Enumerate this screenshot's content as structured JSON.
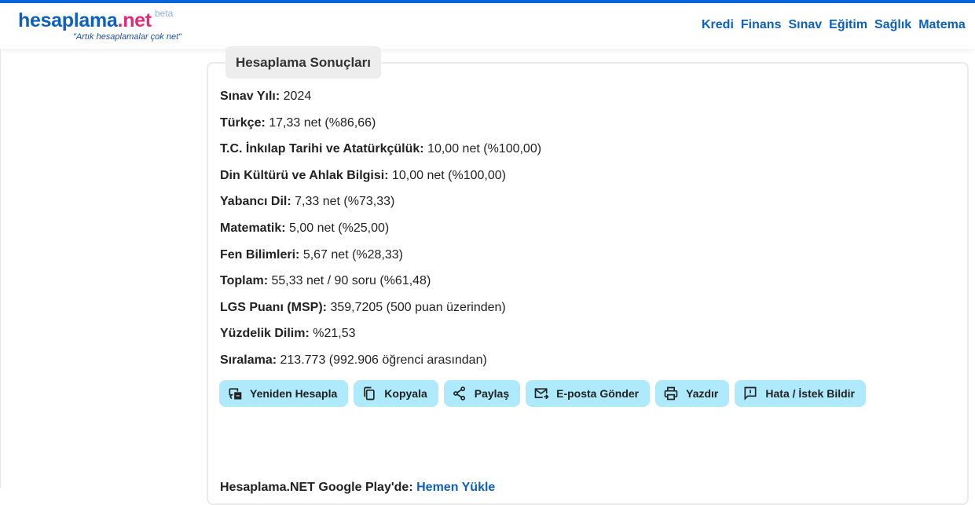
{
  "logo": {
    "name": "hesaplama",
    "tld": ".net",
    "beta": "beta",
    "slogan": "\"Artık hesaplamalar çok net\""
  },
  "nav": {
    "items": [
      "Kredi",
      "Finans",
      "Sınav",
      "Eğitim",
      "Sağlık",
      "Matema"
    ]
  },
  "card": {
    "title": "Hesaplama Sonuçları"
  },
  "results": [
    {
      "label": "Sınav Yılı:",
      "value": "2024"
    },
    {
      "label": "Türkçe:",
      "value": "17,33 net (%86,66)"
    },
    {
      "label": "T.C. İnkılap Tarihi ve Atatürkçülük:",
      "value": "10,00 net (%100,00)"
    },
    {
      "label": "Din Kültürü ve Ahlak Bilgisi:",
      "value": "10,00 net (%100,00)"
    },
    {
      "label": "Yabancı Dil:",
      "value": "7,33 net (%73,33)"
    },
    {
      "label": "Matematik:",
      "value": "5,00 net (%25,00)"
    },
    {
      "label": "Fen Bilimleri:",
      "value": "5,67 net (%28,33)"
    },
    {
      "label": "Toplam:",
      "value": "55,33 net / 90 soru (%61,48)"
    },
    {
      "label": "LGS Puanı (MSP):",
      "value": "359,7205 (500 puan üzerinden)"
    },
    {
      "label": "Yüzdelik Dilim:",
      "value": "%21,53"
    },
    {
      "label": "Sıralama:",
      "value": "213.773 (992.906 öğrenci arasından)"
    }
  ],
  "actions": {
    "recalc": "Yeniden Hesapla",
    "copy": "Kopyala",
    "share": "Paylaş",
    "email": "E-posta Gönder",
    "print": "Yazdır",
    "report": "Hata / İstek Bildir"
  },
  "footer": {
    "text": "Hesaplama.NET Google Play'de:",
    "link": "Hemen Yükle"
  },
  "colors": {
    "accent": "#0d5fc0",
    "logo_tld": "#e6287a",
    "button_bg": "#aeeafc",
    "top_bar": "#0a64d6"
  }
}
